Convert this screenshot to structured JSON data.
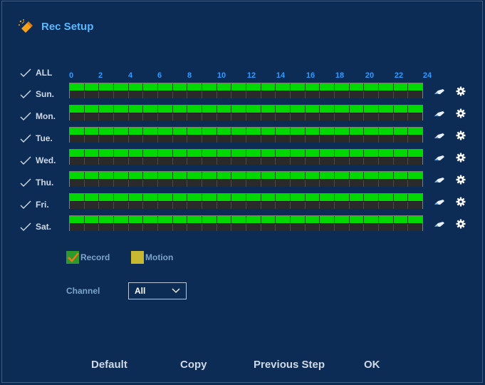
{
  "header": {
    "title": "Rec Setup",
    "icon": "setup-wand-icon"
  },
  "days": [
    {
      "label": "ALL"
    },
    {
      "label": "Sun."
    },
    {
      "label": "Mon."
    },
    {
      "label": "Tue."
    },
    {
      "label": "Wed."
    },
    {
      "label": "Thu."
    },
    {
      "label": "Fri."
    },
    {
      "label": "Sat."
    }
  ],
  "hour_ticks": [
    "0",
    "2",
    "4",
    "6",
    "8",
    "10",
    "12",
    "14",
    "16",
    "18",
    "20",
    "22",
    "24"
  ],
  "schedule": {
    "slots_per_day": 24,
    "record_color": "#00d800",
    "empty_color": "#2a2a2a",
    "record_all_day": true
  },
  "legend": {
    "record": {
      "label": "Record",
      "color": "#2e9a2e"
    },
    "motion": {
      "label": "Motion",
      "color": "#c8b933"
    }
  },
  "channel": {
    "label": "Channel",
    "value": "All"
  },
  "footer": {
    "default_label": "Default",
    "copy_label": "Copy",
    "previous_label": "Previous Step",
    "ok_label": "OK"
  },
  "colors": {
    "background": "#0d2c55",
    "accent": "#5ab8ff",
    "hour_tick": "#2f9bff"
  }
}
